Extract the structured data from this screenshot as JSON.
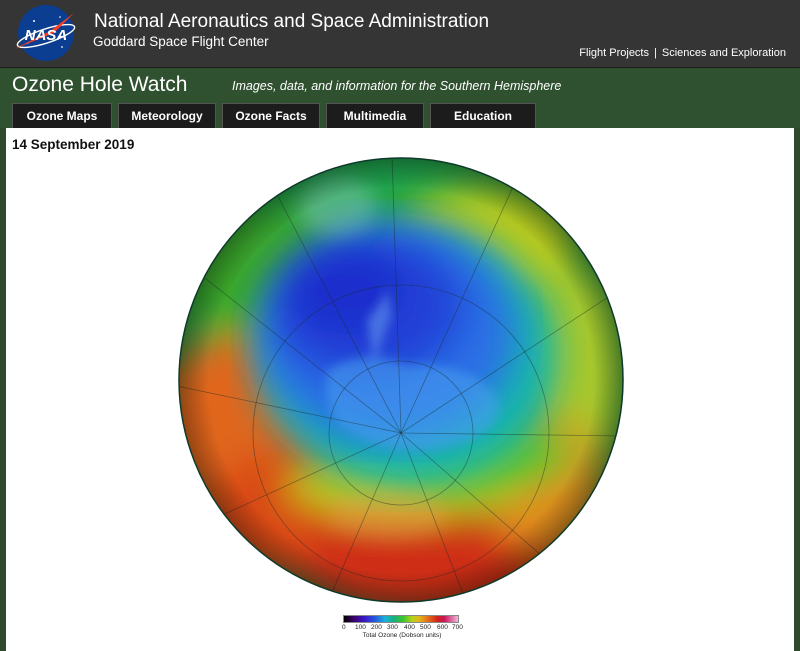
{
  "header": {
    "agency": "National Aeronautics and Space Administration",
    "center": "Goddard Space Flight Center",
    "logo_text": "NASA",
    "links": [
      "Flight Projects",
      "Sciences and Exploration"
    ]
  },
  "site": {
    "title": "Ozone Hole Watch",
    "tagline": "Images, data, and information for the Southern Hemisphere",
    "nav": [
      "Ozone Maps",
      "Meteorology",
      "Ozone Facts",
      "Multimedia",
      "Education"
    ]
  },
  "content": {
    "date": "14 September 2019",
    "legend": {
      "ticks": [
        "0",
        "100",
        "200",
        "300",
        "400",
        "500",
        "600",
        "700"
      ],
      "label": "Total Ozone (Dobson units)"
    }
  },
  "colors": {
    "header_bg": "#353535",
    "band_bg": "#2f5130",
    "tab_bg": "#1c1c1c"
  }
}
